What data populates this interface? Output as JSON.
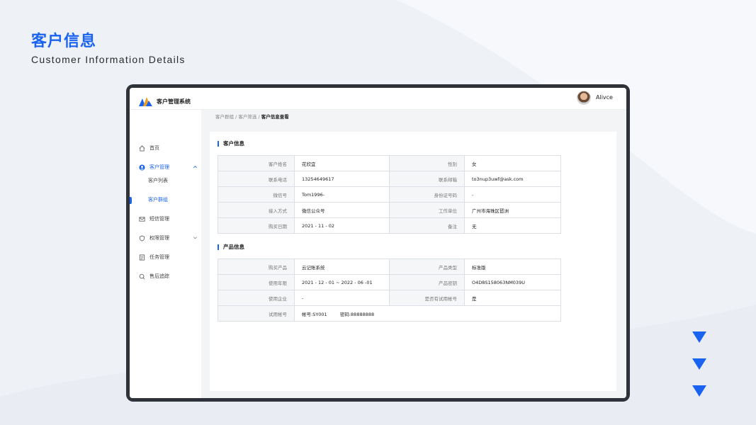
{
  "page": {
    "title": "客户信息",
    "subtitle": "Customer Information Details"
  },
  "app": {
    "name": "客户管理系统",
    "user": "Alivce"
  },
  "sidebar": {
    "items": [
      {
        "label": "首页",
        "icon": "home-icon"
      },
      {
        "label": "客户管理",
        "icon": "user-circle-icon",
        "expanded": true
      },
      {
        "label": "客户列表"
      },
      {
        "label": "客户群组",
        "active": true
      },
      {
        "label": "短信管理",
        "icon": "mail-icon"
      },
      {
        "label": "权限管理",
        "icon": "shield-icon"
      },
      {
        "label": "任务管理",
        "icon": "task-icon"
      },
      {
        "label": "售后追踪",
        "icon": "tracking-icon"
      }
    ]
  },
  "breadcrumb": {
    "items": [
      "客户群组",
      "客户筛选"
    ],
    "separator": "/",
    "current": "客户信息查看"
  },
  "customer_section": {
    "title": "客户信息",
    "rows": [
      {
        "k1": "客户姓名",
        "v1": "花欣宜",
        "k2": "性别",
        "v2": "女"
      },
      {
        "k1": "联系电话",
        "v1": "13254649617",
        "k2": "联系邮箱",
        "v2": "to3nup3uwf@ask.com"
      },
      {
        "k1": "微信号",
        "v1": "Tom1996-",
        "k2": "身份证号码",
        "v2": "-"
      },
      {
        "k1": "接入方式",
        "v1": "微信公众号",
        "k2": "工作单位",
        "v2": "广州市海珠区琶洲"
      },
      {
        "k1": "购买日期",
        "v1": "2021 - 11 - 02",
        "k2": "备注",
        "v2": "无"
      }
    ]
  },
  "product_section": {
    "title": "产品信息",
    "rows": [
      {
        "k1": "购买产品",
        "v1": "云记账系统",
        "k2": "产品类型",
        "v2": "标准版"
      },
      {
        "k1": "使用年限",
        "v1": "2021 - 12 - 01 ~ 2022 - 06 -01",
        "k2": "产品密钥",
        "v2": "O4D8S158063NM039U"
      },
      {
        "k1": "使用企业",
        "v1": "-",
        "k2": "是否有试用帐号",
        "v2": "是"
      }
    ],
    "trial": {
      "label": "试用帐号",
      "account": "帐号:SY001",
      "password": "密码:88888888"
    }
  },
  "colors": {
    "accent": "#1a63f0",
    "frame": "#2f3238",
    "background": "#eef1f6"
  }
}
